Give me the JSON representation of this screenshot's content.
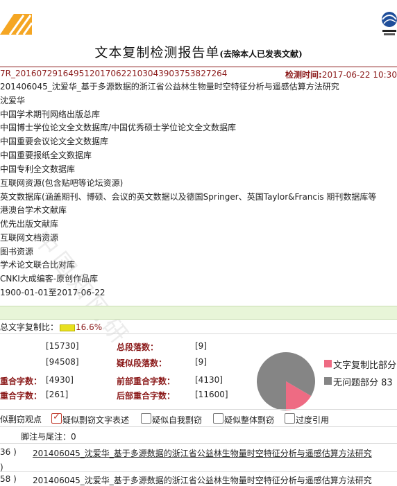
{
  "report": {
    "title": "文本复制检测报告单",
    "title_note": "(去除本人已发表文献)",
    "report_id": "7R_2016072916495120170622103043903753827264",
    "detect_time_label": "检测时间:",
    "detect_time": "2017-06-22 10:30"
  },
  "info_lines": [
    "201406045_沈爱华_基于多源数据的浙江省公益林生物量时空特征分析与遥感估算方法研究",
    "沈爱华",
    "中国学术期刊网络出版总库",
    "中国博士学位论文全文数据库/中国优秀硕士学位论文全文数据库",
    "中国重要会议论文全文数据库",
    "中国重要报纸全文数据库",
    "中国专利全文数据库",
    "互联网资源(包含贴吧等论坛资源)",
    "英文数据库(涵盖期刊、博硕、会议的英文数据以及德国Springer、英国Taylor&Francis 期刊数据库等",
    "港澳台学术文献库",
    "优先出版文献库",
    "互联网文档资源",
    "图书资源",
    "学术论文联合比对库",
    "CNKI大成编客-原创作品库",
    "1900-01-01至2017-06-22"
  ],
  "watermark": "中国知网研",
  "summary": {
    "ratio_label": "总文字复制比：",
    "ratio_value": "16.6%",
    "ratio_fraction": 0.166,
    "stats": [
      {
        "label": "",
        "value": "[15730]"
      },
      {
        "label": "总段落数：",
        "value": "[9]"
      },
      {
        "label": "",
        "value": "[94508]"
      },
      {
        "label": "疑似段落数：",
        "value": "[9]"
      },
      {
        "label": "重合字数：",
        "value": "[4930]"
      },
      {
        "label": "前部重合字数：",
        "value": "[4130]"
      },
      {
        "label": "重合字数：",
        "value": "[261]"
      },
      {
        "label": "后部重合字数：",
        "value": "[11600]"
      }
    ]
  },
  "chart_data": {
    "type": "pie",
    "slices": [
      {
        "name": "文字复制比部分",
        "value": 16.6,
        "color": "#ee6b83"
      },
      {
        "name": "无问题部分",
        "value": 83.4,
        "color": "#858585"
      }
    ],
    "legend": [
      "文字复制比部分",
      "无问题部分 83"
    ],
    "legend_position": "right"
  },
  "options": {
    "lead": "似剽窃观点",
    "items": [
      {
        "label": "疑似剽窃文字表述",
        "checked": true
      },
      {
        "label": "疑似自我剽窃",
        "checked": false
      },
      {
        "label": "疑似整体剽窃",
        "checked": false
      },
      {
        "label": "过度引用",
        "checked": false
      }
    ]
  },
  "footnote": "脚注与尾注：0",
  "rows": [
    {
      "prefix": "36 )",
      "text": "201406045_沈爱华_基于多源数据的浙江省公益林生物量时空特征分析与遥感估算方法研究"
    },
    {
      "prefix": ")",
      "text": ""
    },
    {
      "prefix": "58 )",
      "text": "201406045_沈爱华_基于多源数据的浙江省公益林生物量时空特征分析与遥感估算方法研究"
    }
  ],
  "colors": {
    "accent": "#8b1a1a",
    "band": "#e8f5d8",
    "copy": "#ee6b83",
    "clean": "#858585"
  }
}
